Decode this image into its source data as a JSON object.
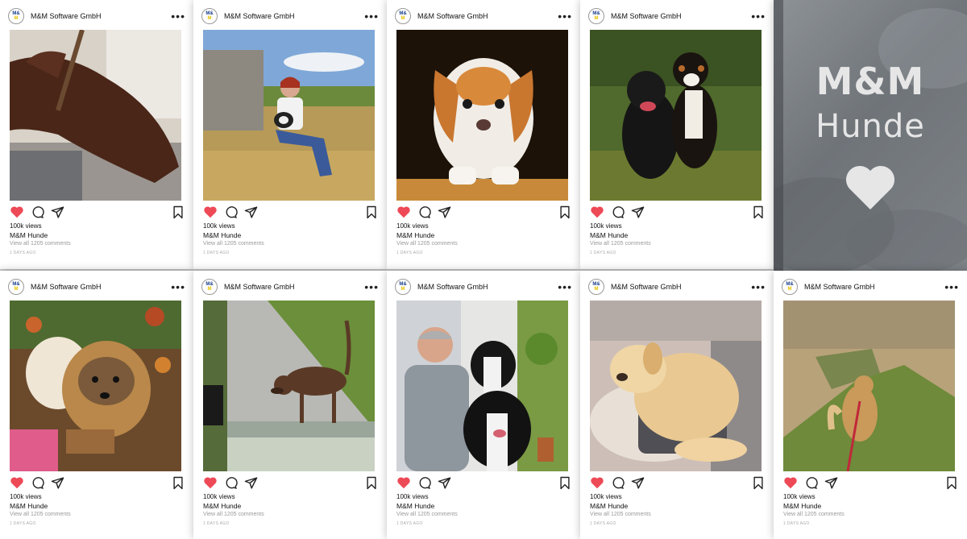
{
  "brand": "M&M Software GmbH",
  "logo_text": {
    "top": "M&",
    "bottom": "M"
  },
  "colors": {
    "like": "#ed4956",
    "text": "#111111",
    "muted": "#999999",
    "logo_blue": "#1a3e8c",
    "logo_yellow": "#e6c200"
  },
  "icons": {
    "like": "heart-icon",
    "comment": "comment-icon",
    "share": "paper-plane-icon",
    "save": "bookmark-icon",
    "menu": "more-options-icon"
  },
  "promo": {
    "line1": "M&M",
    "line2": "Hunde"
  },
  "posts": [
    {
      "views": "100k views",
      "user": "M&M Hunde",
      "comments": "View all 1205 comments",
      "ago": "1 DAYS AGO",
      "photo": "Brown dog sleeping on a couch"
    },
    {
      "views": "100k views",
      "user": "M&M Hunde",
      "comments": "View all 1205 comments",
      "ago": "1 DAYS AGO",
      "photo": "Woman sitting on hay bales with a small dog"
    },
    {
      "views": "100k views",
      "user": "M&M Hunde",
      "comments": "View all 1205 comments",
      "ago": "1 DAYS AGO",
      "photo": "White and tan small dog portrait"
    },
    {
      "views": "100k views",
      "user": "M&M Hunde",
      "comments": "View all 1205 comments",
      "ago": "1 DAYS AGO",
      "photo": "Black dog and Bernese dog in a meadow"
    },
    {
      "views": "100k views",
      "user": "M&M Hunde",
      "comments": "View all 1205 comments",
      "ago": "1 DAYS AGO",
      "photo": "Fluffy small dog among autumn leaves"
    },
    {
      "views": "100k views",
      "user": "M&M Hunde",
      "comments": "View all 1205 comments",
      "ago": "1 DAYS AGO",
      "photo": "Dachshund on a garden path"
    },
    {
      "views": "100k views",
      "user": "M&M Hunde",
      "comments": "View all 1205 comments",
      "ago": "1 DAYS AGO",
      "photo": "Man with glasses and two border collies"
    },
    {
      "views": "100k views",
      "user": "M&M Hunde",
      "comments": "View all 1205 comments",
      "ago": "1 DAYS AGO",
      "photo": "Golden retriever puppy sleeping on a dog bed"
    },
    {
      "views": "100k views",
      "user": "M&M Hunde",
      "comments": "View all 1205 comments",
      "ago": "1 DAYS AGO",
      "photo": "Small dog on a leash on a sandy hill"
    }
  ]
}
